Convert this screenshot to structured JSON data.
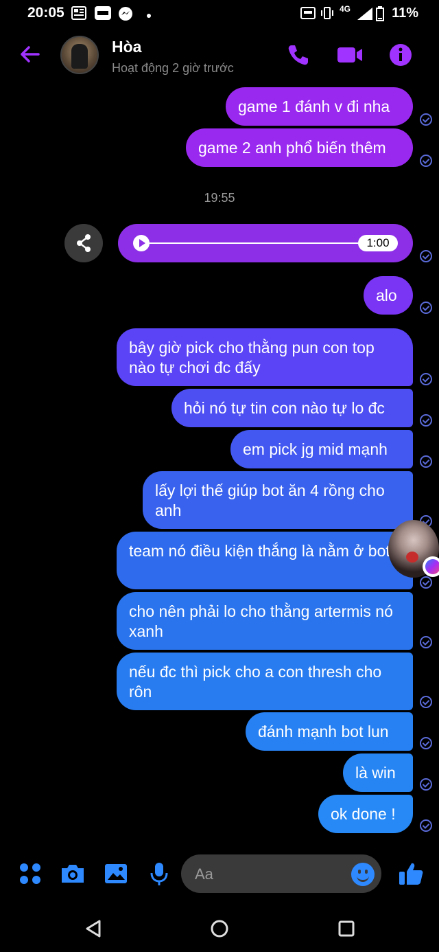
{
  "status_bar": {
    "time": "20:05",
    "network": "4G",
    "battery": "11%"
  },
  "header": {
    "contact_name": "Hòa",
    "activity_status": "Hoạt động 2 giờ trước"
  },
  "colors": {
    "accent_purple": "#8c2fe6",
    "accent_blue": "#2e89ff",
    "receipt": "#5a6bd8"
  },
  "chat": {
    "messages_top": [
      "game 1 đánh v đi nha",
      "game 2 anh phổ biến thêm"
    ],
    "timestamp": "19:55",
    "voice_message": {
      "duration": "1:00",
      "progress": 0
    },
    "messages": [
      "alo",
      "bây giờ pick cho thằng pun con top nào tự chơi đc đấy",
      "hỏi nó tự tin con nào tự lo đc",
      "em pick jg mid mạnh",
      "lấy lợi thế giúp bot ăn 4 rồng cho anh",
      "team nó điều kiện thắng là nằm ở bot",
      "cho nên phải lo cho thằng artermis nó xanh",
      "nếu đc thì pick cho a con thresh cho rôn",
      "đánh mạnh bot lun",
      "là win",
      "ok done !"
    ]
  },
  "composer": {
    "placeholder": "Aa"
  },
  "icons": {
    "back": "arrow-left-icon",
    "call": "phone-icon",
    "video": "video-camera-icon",
    "info": "info-icon",
    "share": "share-icon",
    "apps": "four-dots-icon",
    "camera": "camera-icon",
    "gallery": "image-icon",
    "mic": "microphone-icon",
    "emoji": "emoji-icon",
    "like": "thumbs-up-icon"
  }
}
